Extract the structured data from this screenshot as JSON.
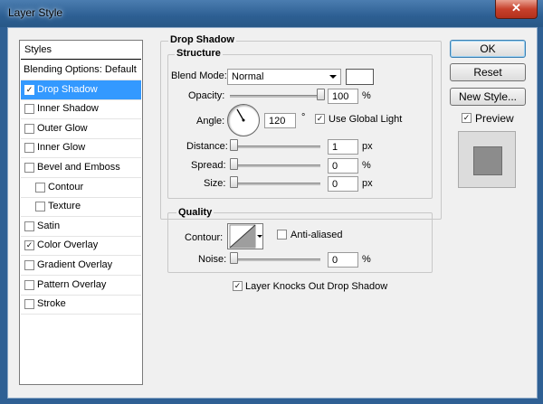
{
  "window": {
    "title": "Layer Style",
    "close_glyph": "✕"
  },
  "styles_list": {
    "header": "Styles",
    "items": [
      {
        "label": "Blending Options: Default",
        "checkbox": false,
        "checked": false,
        "selected": false
      },
      {
        "label": "Drop Shadow",
        "checkbox": true,
        "checked": true,
        "selected": true
      },
      {
        "label": "Inner Shadow",
        "checkbox": true,
        "checked": false,
        "selected": false
      },
      {
        "label": "Outer Glow",
        "checkbox": true,
        "checked": false,
        "selected": false
      },
      {
        "label": "Inner Glow",
        "checkbox": true,
        "checked": false,
        "selected": false
      },
      {
        "label": "Bevel and Emboss",
        "checkbox": true,
        "checked": false,
        "selected": false
      },
      {
        "label": "Contour",
        "checkbox": true,
        "checked": false,
        "selected": false,
        "indent": true
      },
      {
        "label": "Texture",
        "checkbox": true,
        "checked": false,
        "selected": false,
        "indent": true
      },
      {
        "label": "Satin",
        "checkbox": true,
        "checked": false,
        "selected": false
      },
      {
        "label": "Color Overlay",
        "checkbox": true,
        "checked": true,
        "selected": false
      },
      {
        "label": "Gradient Overlay",
        "checkbox": true,
        "checked": false,
        "selected": false
      },
      {
        "label": "Pattern Overlay",
        "checkbox": true,
        "checked": false,
        "selected": false
      },
      {
        "label": "Stroke",
        "checkbox": true,
        "checked": false,
        "selected": false
      }
    ]
  },
  "drop_shadow": {
    "group_title": "Drop Shadow",
    "structure": {
      "title": "Structure",
      "blend_mode_label": "Blend Mode:",
      "blend_mode_value": "Normal",
      "shadow_color": "#ffffff",
      "opacity_label": "Opacity:",
      "opacity_value": "100",
      "opacity_unit": "%",
      "opacity_fraction": 1.0,
      "angle_label": "Angle:",
      "angle_value": "120",
      "angle_unit": "°",
      "angle_degrees": 120,
      "use_global_light_label": "Use Global Light",
      "use_global_light_checked": true,
      "distance_label": "Distance:",
      "distance_value": "1",
      "distance_unit": "px",
      "distance_fraction": 0.0,
      "spread_label": "Spread:",
      "spread_value": "0",
      "spread_unit": "%",
      "spread_fraction": 0.0,
      "size_label": "Size:",
      "size_value": "0",
      "size_unit": "px",
      "size_fraction": 0.0
    },
    "quality": {
      "title": "Quality",
      "contour_label": "Contour:",
      "anti_aliased_label": "Anti-aliased",
      "anti_aliased_checked": false,
      "noise_label": "Noise:",
      "noise_value": "0",
      "noise_unit": "%",
      "noise_fraction": 0.0
    },
    "knocks_out_label": "Layer Knocks Out Drop Shadow",
    "knocks_out_checked": true
  },
  "buttons": {
    "ok": "OK",
    "reset": "Reset",
    "new_style": "New Style..."
  },
  "preview": {
    "label": "Preview",
    "checked": true
  }
}
